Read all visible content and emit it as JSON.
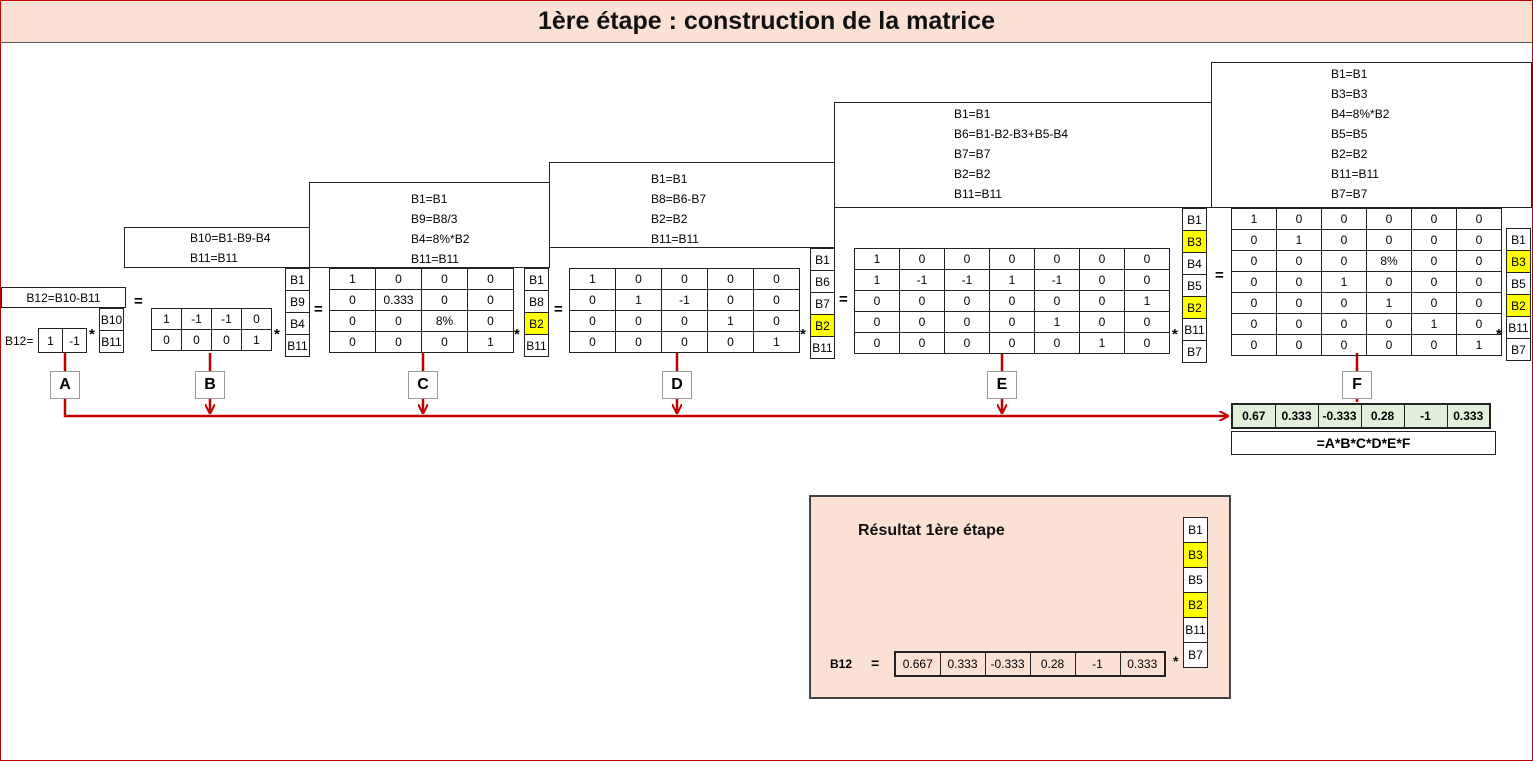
{
  "title": "1ère étape : construction de la matrice",
  "colors": {
    "title_bg": "#fbe0d4",
    "highlight": "#ffff00",
    "arrow": "#c00000",
    "result_green": "#e2efda"
  },
  "A": {
    "rules": [
      "B12=B10-B11"
    ],
    "prefix": "B12=",
    "rows": [
      [
        "1",
        "-1"
      ]
    ],
    "labels": [
      "B10",
      "B11"
    ],
    "letter": "A"
  },
  "B": {
    "rules": [
      "B10=B1-B9-B4",
      "B11=B11"
    ],
    "rows": [
      [
        "1",
        "-1",
        "-1",
        "0"
      ],
      [
        "0",
        "0",
        "0",
        "1"
      ]
    ],
    "labels": [
      "B1",
      "B9",
      "B4",
      "B11"
    ],
    "letter": "B"
  },
  "C": {
    "rules": [
      "B1=B1",
      "B9=B8/3",
      "B4=8%*B2",
      "B11=B11"
    ],
    "rows": [
      [
        "1",
        "0",
        "0",
        "0"
      ],
      [
        "0",
        "0.333",
        "0",
        "0"
      ],
      [
        "0",
        "0",
        "8%",
        "0"
      ],
      [
        "0",
        "0",
        "0",
        "1"
      ]
    ],
    "labels": [
      "B1",
      "B8",
      "B2",
      "B11"
    ],
    "highlight": [
      2
    ],
    "letter": "C"
  },
  "D": {
    "rules": [
      "B1=B1",
      "B8=B6-B7",
      "B2=B2",
      "B11=B11"
    ],
    "rows": [
      [
        "1",
        "0",
        "0",
        "0",
        "0"
      ],
      [
        "0",
        "1",
        "-1",
        "0",
        "0"
      ],
      [
        "0",
        "0",
        "0",
        "1",
        "0"
      ],
      [
        "0",
        "0",
        "0",
        "0",
        "1"
      ]
    ],
    "labels": [
      "B1",
      "B6",
      "B7",
      "B2",
      "B11"
    ],
    "highlight": [
      3
    ],
    "letter": "D"
  },
  "E": {
    "rules": [
      "B1=B1",
      "B6=B1-B2-B3+B5-B4",
      "B7=B7",
      "B2=B2",
      "B11=B11"
    ],
    "rows": [
      [
        "1",
        "0",
        "0",
        "0",
        "0",
        "0",
        "0"
      ],
      [
        "1",
        "-1",
        "-1",
        "1",
        "-1",
        "0",
        "0"
      ],
      [
        "0",
        "0",
        "0",
        "0",
        "0",
        "0",
        "1"
      ],
      [
        "0",
        "0",
        "0",
        "0",
        "1",
        "0",
        "0"
      ],
      [
        "0",
        "0",
        "0",
        "0",
        "0",
        "1",
        "0"
      ]
    ],
    "labels": [
      "B1",
      "B3",
      "B4",
      "B5",
      "B2",
      "B11",
      "B7"
    ],
    "highlight": [
      1,
      4
    ],
    "letter": "E"
  },
  "F": {
    "rules": [
      "B1=B1",
      "B3=B3",
      "B4=8%*B2",
      "B5=B5",
      "B2=B2",
      "B11=B11",
      "B7=B7"
    ],
    "rows": [
      [
        "1",
        "0",
        "0",
        "0",
        "0",
        "0"
      ],
      [
        "0",
        "1",
        "0",
        "0",
        "0",
        "0"
      ],
      [
        "0",
        "0",
        "0",
        "8%",
        "0",
        "0"
      ],
      [
        "0",
        "0",
        "1",
        "0",
        "0",
        "0"
      ],
      [
        "0",
        "0",
        "0",
        "1",
        "0",
        "0"
      ],
      [
        "0",
        "0",
        "0",
        "0",
        "1",
        "0"
      ],
      [
        "0",
        "0",
        "0",
        "0",
        "0",
        "1"
      ]
    ],
    "labels": [
      "B1",
      "B3",
      "B5",
      "B2",
      "B11",
      "B7"
    ],
    "highlight": [
      1,
      3
    ],
    "letter": "F"
  },
  "product": {
    "values": [
      "0.67",
      "0.333",
      "-0.333",
      "0.28",
      "-1",
      "0.333"
    ],
    "formula": "=A*B*C*D*E*F"
  },
  "result": {
    "heading": "Résultat 1ère étape",
    "label": "B12",
    "equals": "=",
    "values": [
      "0.667",
      "0.333",
      "-0.333",
      "0.28",
      "-1",
      "0.333"
    ],
    "star": "*",
    "labels": [
      "B1",
      "B3",
      "B5",
      "B2",
      "B11",
      "B7"
    ],
    "highlight": [
      1,
      3
    ]
  },
  "operators": {
    "star": "*",
    "equals": "="
  }
}
